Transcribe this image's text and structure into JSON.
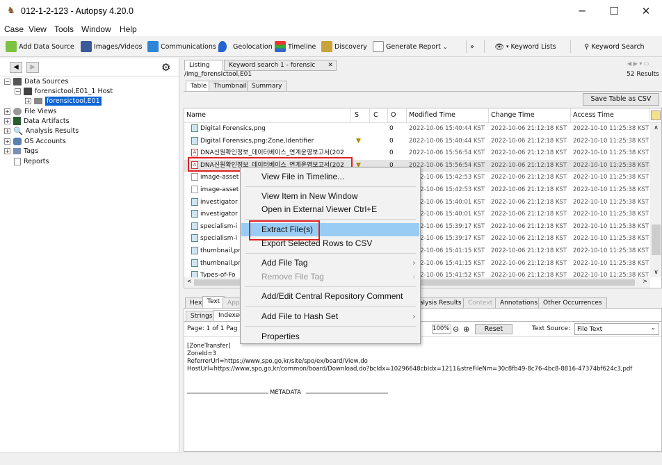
{
  "window": {
    "title": "012-1-2-123 - Autopsy 4.20.0",
    "minimize": "─",
    "maximize": "☐",
    "close": "✕"
  },
  "menu": [
    "Case",
    "View",
    "Tools",
    "Window",
    "Help"
  ],
  "toolbar": {
    "add_data_source": "Add Data Source",
    "images_videos": "Images/Videos",
    "communications": "Communications",
    "geolocation": "Geolocation",
    "timeline": "Timeline",
    "discovery": "Discovery",
    "generate_report": "Generate Report",
    "keyword_lists": "Keyword Lists",
    "keyword_search": "Keyword Search"
  },
  "tree": {
    "data_sources": "Data Sources",
    "host": "forensictool,E01_1 Host",
    "image": "forensictool,E01",
    "file_views": "File Views",
    "data_artifacts": "Data Artifacts",
    "analysis_results": "Analysis Results",
    "os_accounts": "OS Accounts",
    "tags": "Tags",
    "reports": "Reports"
  },
  "result_tabs": {
    "listing": "Listing",
    "keyword": "Keyword search 1 - forensic",
    "close": "✕"
  },
  "path": "/img_forensictool,E01",
  "result_count": "52 Results",
  "view_tabs": {
    "table": "Table",
    "thumbnail": "Thumbnail",
    "summary": "Summary"
  },
  "save_table": "Save Table as CSV",
  "columns": {
    "name": "Name",
    "s": "S",
    "c": "C",
    "o": "O",
    "modified": "Modified Time",
    "change": "Change Time",
    "access": "Access Time"
  },
  "rows": [
    {
      "name": "Digital Forensics,png",
      "s": "",
      "o": "0",
      "m": "2022-10-06 15:40:44 KST",
      "c": "2022-10-06 21:12:18 KST",
      "a": "2022-10-10 11:25:38 KST",
      "icon": "img"
    },
    {
      "name": "Digital Forensics,png:Zone,Identifier",
      "s": "▼",
      "o": "0",
      "m": "2022-10-06 15:40:44 KST",
      "c": "2022-10-06 21:12:18 KST",
      "a": "2022-10-10 11:25:38 KST",
      "icon": "img"
    },
    {
      "name": "DNA신원확인정보_데이터베이스_연계운영보고서(202",
      "s": "",
      "o": "0",
      "m": "2022-10-06 15:56:54 KST",
      "c": "2022-10-06 21:12:18 KST",
      "a": "2022-10-10 11:25:38 KST",
      "icon": "pdf"
    },
    {
      "name": "DNA신원확인정보_데이터베이스_연계운영보고서(202",
      "s": "▼",
      "o": "0",
      "m": "2022-10-06 15:56:54 KST",
      "c": "2022-10-06 21:12:18 KST",
      "a": "2022-10-10 11:25:38 KST",
      "icon": "pdf"
    },
    {
      "name": "image-asset",
      "s": "",
      "o": "",
      "m": "2022-10-06 15:42:53 KST",
      "c": "2022-10-06 21:12:18 KST",
      "a": "2022-10-10 11:25:38 KST",
      "icon": "blank"
    },
    {
      "name": "image-asset",
      "s": "",
      "o": "",
      "m": "2022-10-06 15:42:53 KST",
      "c": "2022-10-06 21:12:18 KST",
      "a": "2022-10-10 11:25:38 KST",
      "icon": "blank"
    },
    {
      "name": "investigator",
      "s": "",
      "o": "",
      "m": "2022-10-06 15:40:01 KST",
      "c": "2022-10-06 21:12:18 KST",
      "a": "2022-10-10 11:25:38 KST",
      "icon": "img"
    },
    {
      "name": "investigator",
      "s": "",
      "o": "",
      "m": "2022-10-06 15:40:01 KST",
      "c": "2022-10-06 21:12:18 KST",
      "a": "2022-10-10 11:25:38 KST",
      "icon": "img"
    },
    {
      "name": "specialism-i",
      "s": "",
      "o": "",
      "m": "2022-10-06 15:39:17 KST",
      "c": "2022-10-06 21:12:18 KST",
      "a": "2022-10-10 11:25:38 KST",
      "icon": "img"
    },
    {
      "name": "specialism-i",
      "s": "",
      "o": "",
      "m": "2022-10-06 15:39:17 KST",
      "c": "2022-10-06 21:12:18 KST",
      "a": "2022-10-10 11:25:38 KST",
      "icon": "img"
    },
    {
      "name": "thumbnail,pn",
      "s": "",
      "o": "",
      "m": "2022-10-06 15:41:15 KST",
      "c": "2022-10-06 21:12:18 KST",
      "a": "2022-10-10 11:25:38 KST",
      "icon": "img"
    },
    {
      "name": "thumbnail,pn",
      "s": "",
      "o": "",
      "m": "2022-10-06 15:41:15 KST",
      "c": "2022-10-06 21:12:18 KST",
      "a": "2022-10-10 11:25:38 KST",
      "icon": "img"
    },
    {
      "name": "Types-of-Fo",
      "s": "",
      "o": "",
      "m": "2022-10-06 15:41:52 KST",
      "c": "2022-10-06 21:12:18 KST",
      "a": "2022-10-10 11:25:38 KST",
      "icon": "img"
    }
  ],
  "lower_tabs": {
    "hex": "Hex",
    "text": "Text",
    "appl": "Appli",
    "analysis": "alysis Results",
    "context": "Context",
    "annotations": "Annotations",
    "other": "Other Occurrences"
  },
  "sub_tabs": {
    "strings": "Strings",
    "indexed": "Indexed"
  },
  "pager": {
    "page": "Page: 1 of 1 Pag",
    "zoom": "100%",
    "reset": "Reset",
    "text_source_label": "Text Source:",
    "text_source_value": "File Text"
  },
  "content": {
    "l1": "[ZoneTransfer]",
    "l2": "ZoneId=3",
    "l3": "ReferrerUrl=https://www,spo,go,kr/site/spo/ex/board/View,do",
    "l4": "HostUrl=https://www,spo,go,kr/common/board/Download,do?bcIdx=10296648cbIdx=1211&streFileNm=30c8fb49-8c76-4bc8-8816-47374bf624c3,pdf",
    "meta": "METADATA"
  },
  "context_menu": {
    "view_timeline": "View File in Timeline...",
    "view_item": "View Item in New Window",
    "open_external": "Open in External Viewer  Ctrl+E",
    "extract": "Extract File(s)",
    "export_rows": "Export Selected Rows to CSV",
    "add_tag": "Add File Tag",
    "remove_tag": "Remove File Tag",
    "add_comment": "Add/Edit Central Repository Comment",
    "add_hash": "Add File to Hash Set",
    "properties": "Properties"
  }
}
